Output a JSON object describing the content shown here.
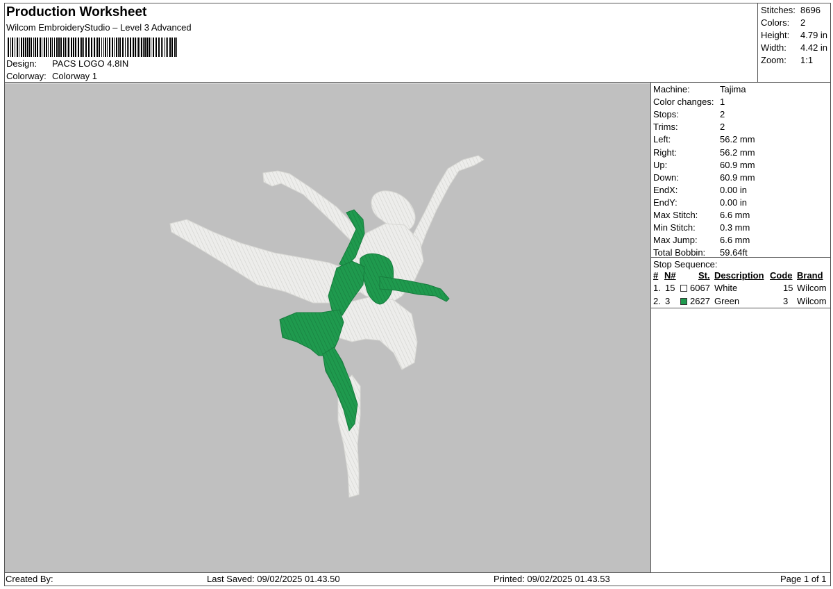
{
  "header": {
    "title": "Production Worksheet",
    "subtitle": "Wilcom EmbroideryStudio – Level 3 Advanced",
    "design_label": "Design:",
    "design_value": "PACS LOGO 4.8IN",
    "colorway_label": "Colorway:",
    "colorway_value": "Colorway 1"
  },
  "stats": [
    {
      "label": "Stitches:",
      "value": "8696"
    },
    {
      "label": "Colors:",
      "value": "2"
    },
    {
      "label": "Height:",
      "value": "4.79 in"
    },
    {
      "label": "Width:",
      "value": "4.42 in"
    },
    {
      "label": "Zoom:",
      "value": "1:1"
    }
  ],
  "machine_info": [
    {
      "label": "Machine:",
      "value": "Tajima"
    },
    {
      "label": "Color changes:",
      "value": "1"
    },
    {
      "label": "Stops:",
      "value": "2"
    },
    {
      "label": "Trims:",
      "value": "2"
    },
    {
      "label": "Left:",
      "value": "56.2 mm"
    },
    {
      "label": "Right:",
      "value": "56.2 mm"
    },
    {
      "label": "Up:",
      "value": "60.9 mm"
    },
    {
      "label": "Down:",
      "value": "60.9 mm"
    },
    {
      "label": "EndX:",
      "value": "0.00 in"
    },
    {
      "label": "EndY:",
      "value": "0.00 in"
    },
    {
      "label": "Max Stitch:",
      "value": "6.6 mm"
    },
    {
      "label": "Min Stitch:",
      "value": "0.3 mm"
    },
    {
      "label": "Max Jump:",
      "value": "6.6 mm"
    },
    {
      "label": "Total Bobbin:",
      "value": "59.64ft"
    }
  ],
  "stop_sequence": {
    "title": "Stop Sequence:",
    "headers": [
      "#",
      "N#",
      "St.",
      "Description",
      "Code",
      "Brand"
    ],
    "rows": [
      {
        "num": "1.",
        "n": "15",
        "swatch": "#ffffff",
        "st": "6067",
        "desc": "White",
        "code": "15",
        "brand": "Wilcom"
      },
      {
        "num": "2.",
        "n": "3",
        "swatch": "#1f9a4e",
        "st": "2627",
        "desc": "Green",
        "code": "3",
        "brand": "Wilcom"
      }
    ]
  },
  "footer": {
    "created_by": "Created By:",
    "last_saved": "Last Saved: 09/02/2025 01.43.50",
    "printed": "Printed: 09/02/2025 01.43.53",
    "page": "Page 1 of 1"
  },
  "colors": {
    "canvas_bg": "#c0c0c0",
    "thread_white": "#ececea",
    "thread_green": "#1f9a4e"
  }
}
